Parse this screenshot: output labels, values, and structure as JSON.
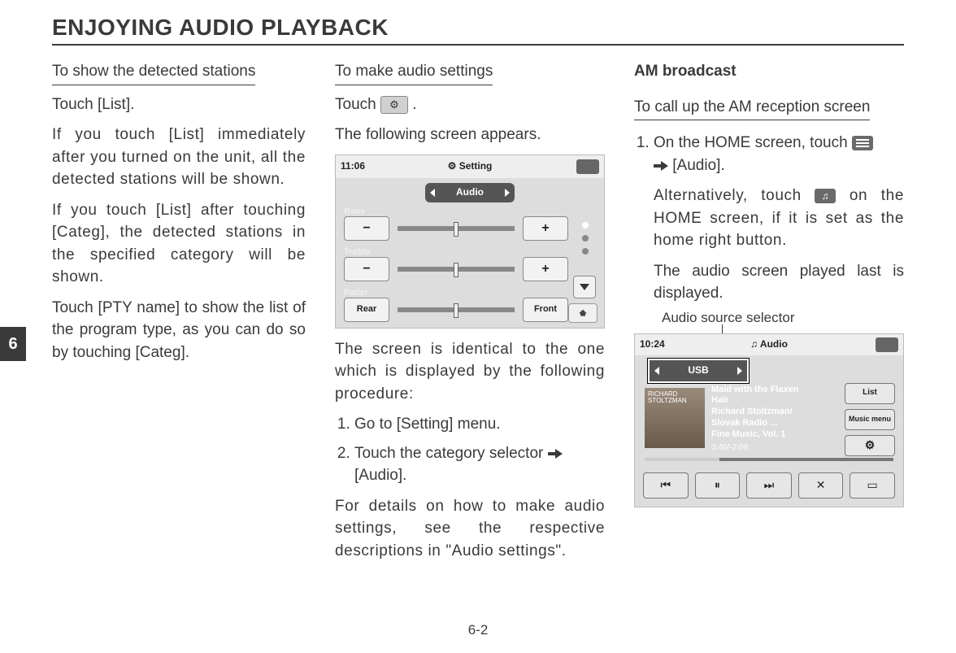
{
  "page": {
    "chapter_tab": "6",
    "number": "6-2",
    "title": "ENJOYING AUDIO PLAYBACK"
  },
  "col1": {
    "heading": "To show the detected stations",
    "p1": "Touch [List].",
    "p2": "If you touch [List] immediately after you turned on the unit, all the detected stations will be shown.",
    "p3": "If you touch [List] after touching [Categ], the detected stations in the specified category will be shown.",
    "p4": "Touch [PTY name] to show the list of the program type, as you can do so by touching [Categ]."
  },
  "col2": {
    "heading": "To make audio settings",
    "p1a": "Touch ",
    "p1b": " .",
    "p2": "The following screen appears.",
    "ss1": {
      "clock": "11:06",
      "title": "⚙ Setting",
      "audio_pill": "Audio",
      "bass": "Bass",
      "treble": "Treble",
      "fader": "Fader",
      "rear": "Rear",
      "front": "Front",
      "minus": "−",
      "plus": "+"
    },
    "p3": "The screen is identical to the one which is displayed by the following procedure:",
    "li1": "Go to [Setting] menu.",
    "li2a": "Touch the category selector ",
    "li2b": " [Audio].",
    "p4": "For details on how to make audio settings, see the respective descriptions in \"Audio settings\"."
  },
  "col3": {
    "heading_bold": "AM broadcast",
    "heading": "To call up the AM reception screen",
    "li1a": "On the HOME screen, touch ",
    "li1b": " [Audio].",
    "p_alt_a": "Alternatively, touch ",
    "p_alt_b": " on the HOME screen, if it is set as the home right button.",
    "p_last": "The audio screen played last is displayed.",
    "callout": "Audio source selector",
    "ss2": {
      "clock": "10:24",
      "title": "♫ Audio",
      "source": "USB",
      "album_text": "RICHARD STOLTZMAN",
      "track": "Maid with the Flaxen Hair",
      "artist": "Richard Stoltzman/ Slovak Radio ...",
      "album": "Fine Music, Vol. 1",
      "time": "0:40/-2:09",
      "list": "List",
      "music_menu": "Music menu",
      "gear": "⚙",
      "prev": "⏮",
      "pause": "⏸",
      "next": "⏭",
      "shuffle": "✕",
      "repeat": "▭"
    }
  }
}
